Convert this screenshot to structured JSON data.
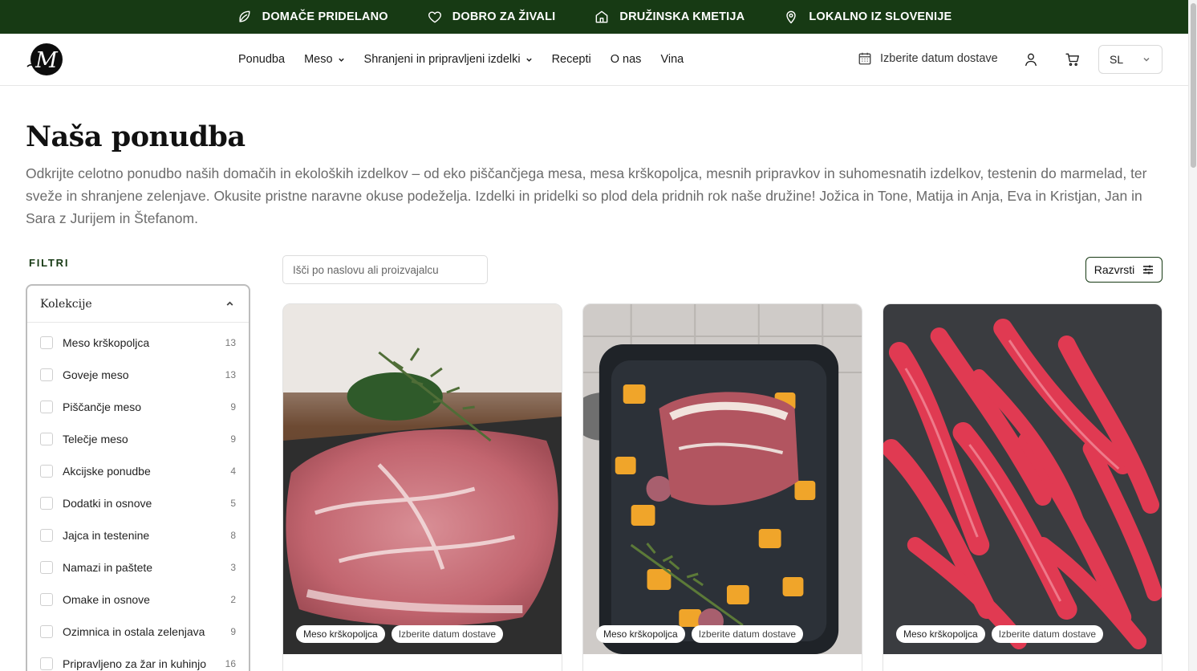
{
  "topbar": {
    "features": [
      {
        "icon": "leaf-icon",
        "label": "DOMAČE PRIDELANO"
      },
      {
        "icon": "heart-icon",
        "label": "DOBRO ZA ŽIVALI"
      },
      {
        "icon": "home-icon",
        "label": "DRUŽINSKA KMETIJA"
      },
      {
        "icon": "map-pin-icon",
        "label": "LOKALNO IZ SLOVENIJE"
      }
    ],
    "background": "#173a14"
  },
  "header": {
    "logo_letter": "M",
    "nav": [
      {
        "label": "Ponudba",
        "dropdown": false
      },
      {
        "label": "Meso",
        "dropdown": true
      },
      {
        "label": "Shranjeni in pripravljeni izdelki",
        "dropdown": true
      },
      {
        "label": "Recepti",
        "dropdown": false
      },
      {
        "label": "O nas",
        "dropdown": false
      },
      {
        "label": "Vina",
        "dropdown": false
      }
    ],
    "delivery_label": "Izberite datum dostave",
    "language": "SL"
  },
  "intro": {
    "title": "Naša ponudba",
    "text": "Odkrijte celotno ponudbo naših domačih in ekoloških izdelkov – od eko piščančjega mesa, mesa krškopoljca, mesnih pripravkov in suhomesnatih izdelkov, testenin do marmelad, ter sveže in shranjene zelenjave. Okusite pristne naravne okuse podeželja. Izdelki in pridelki so plod dela pridnih rok naše družine! Jožica in Tone, Matija in Anja, Eva in Kristjan, Jan in Sara z Jurijem in Štefanom."
  },
  "filters": {
    "heading": "FILTRI",
    "group_title": "Kolekcije",
    "items": [
      {
        "label": "Meso krškopoljca",
        "count": "13"
      },
      {
        "label": "Goveje meso",
        "count": "13"
      },
      {
        "label": "Piščančje meso",
        "count": "9"
      },
      {
        "label": "Telečje meso",
        "count": "9"
      },
      {
        "label": "Akcijske ponudbe",
        "count": "4"
      },
      {
        "label": "Dodatki in osnove",
        "count": "5"
      },
      {
        "label": "Jajca in testenine",
        "count": "8"
      },
      {
        "label": "Namazi in paštete",
        "count": "3"
      },
      {
        "label": "Omake in osnove",
        "count": "2"
      },
      {
        "label": "Ozimnica in ostala zelenjava",
        "count": "9"
      },
      {
        "label": "Pripravljeno za žar in kuhinjo",
        "count": "16"
      }
    ]
  },
  "search": {
    "placeholder": "Išči po naslovu ali proizvajalcu"
  },
  "sort": {
    "label": "Razvrsti"
  },
  "products": [
    {
      "badge_collection": "Meso krškopoljca",
      "badge_delivery": "Izberite datum dostave",
      "image": "pork-neck-steak"
    },
    {
      "badge_collection": "Meso krškopoljca",
      "badge_delivery": "Izberite datum dostave",
      "image": "pork-roast-with-vegetables"
    },
    {
      "badge_collection": "Meso krškopoljca",
      "badge_delivery": "Izberite datum dostave",
      "image": "pork-tenderloin-strips"
    }
  ]
}
